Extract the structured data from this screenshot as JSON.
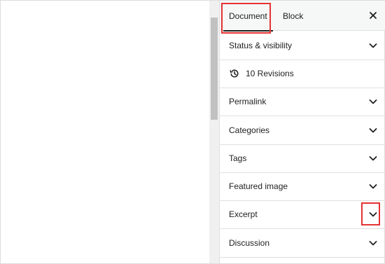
{
  "sidebar": {
    "tabs": [
      {
        "label": "Document",
        "active": true
      },
      {
        "label": "Block",
        "active": false
      }
    ],
    "close_label": "×",
    "panels": [
      {
        "label": "Status & visibility",
        "icon": "chevron-down-icon"
      },
      {
        "label": "10 Revisions",
        "icon": "revisions-icon"
      },
      {
        "label": "Permalink",
        "icon": "chevron-down-icon"
      },
      {
        "label": "Categories",
        "icon": "chevron-down-icon"
      },
      {
        "label": "Tags",
        "icon": "chevron-down-icon"
      },
      {
        "label": "Featured image",
        "icon": "chevron-down-icon"
      },
      {
        "label": "Excerpt",
        "icon": "chevron-down-icon"
      },
      {
        "label": "Discussion",
        "icon": "chevron-down-icon"
      }
    ]
  },
  "annotations": {
    "highlight_color": "#e53333"
  }
}
